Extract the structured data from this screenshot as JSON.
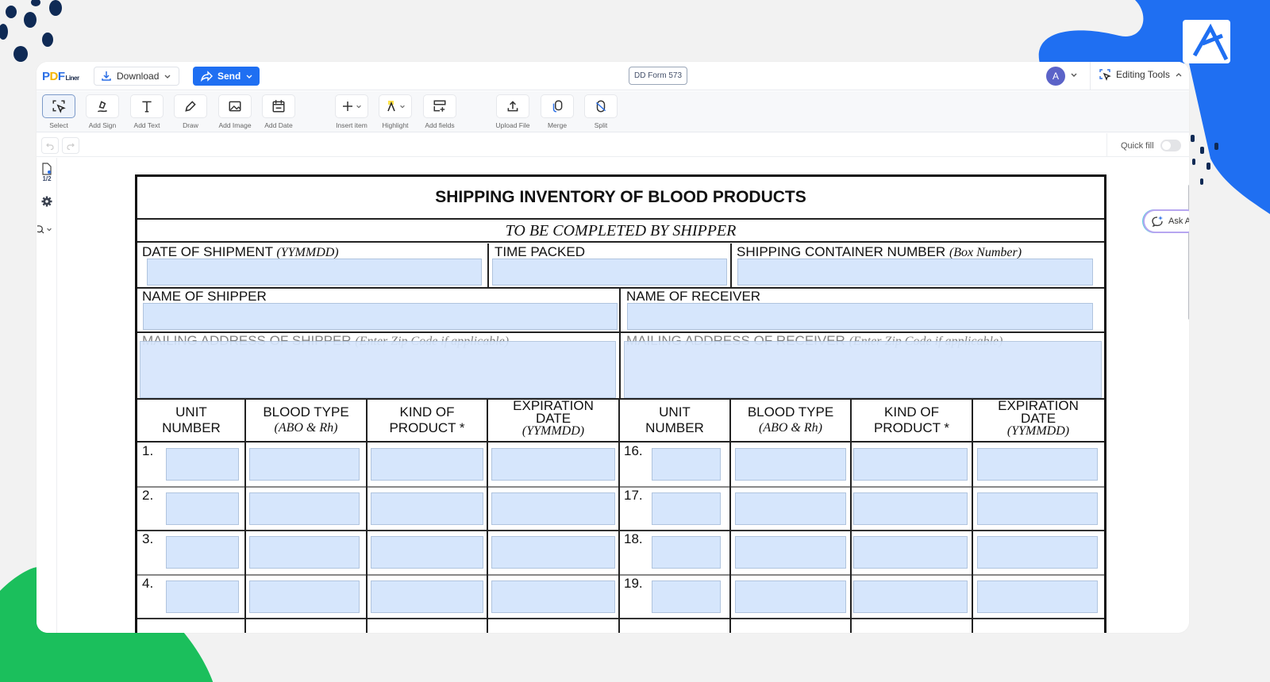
{
  "app": {
    "logo": {
      "p": "P",
      "d": "D",
      "f": "F",
      "liner": "Liner"
    },
    "download_label": "Download",
    "send_label": "Send",
    "document_name": "DD Form 573",
    "avatar_initial": "A",
    "editing_tools_label": "Editing Tools",
    "accent_color": "#1f6ff2"
  },
  "toolbar": {
    "tools": [
      {
        "label": "Select",
        "icon": "select-icon",
        "active": true
      },
      {
        "label": "Add Sign",
        "icon": "sign-icon"
      },
      {
        "label": "Add Text",
        "icon": "text-icon"
      },
      {
        "label": "Draw",
        "icon": "draw-icon"
      },
      {
        "label": "Add Image",
        "icon": "image-icon"
      },
      {
        "label": "Add Date",
        "icon": "calendar-icon"
      },
      {
        "label": "Insert item",
        "icon": "plus-icon"
      },
      {
        "label": "Highlight",
        "icon": "highlight-icon"
      },
      {
        "label": "Add fields",
        "icon": "add-fields-icon"
      },
      {
        "label": "Upload File",
        "icon": "upload-icon"
      },
      {
        "label": "Merge",
        "icon": "merge-icon"
      },
      {
        "label": "Split",
        "icon": "split-icon"
      }
    ]
  },
  "subbar": {
    "quick_fill_label": "Quick fill",
    "quick_fill_on": false
  },
  "sidebar": {
    "page_indicator": "1/2"
  },
  "ask_ai_label": "Ask A",
  "form": {
    "title": "SHIPPING INVENTORY OF BLOOD PRODUCTS",
    "subtitle": "TO BE COMPLETED BY SHIPPER",
    "date_of_shipment": {
      "label": "DATE OF SHIPMENT",
      "hint": "(YYMMDD)",
      "value": ""
    },
    "time_packed": {
      "label": "TIME PACKED",
      "value": ""
    },
    "container_number": {
      "label": "SHIPPING CONTAINER NUMBER",
      "hint": "(Box Number)",
      "value": ""
    },
    "name_of_shipper": {
      "label": "NAME OF SHIPPER",
      "value": ""
    },
    "name_of_receiver": {
      "label": "NAME OF RECEIVER",
      "value": ""
    },
    "mailing_shipper": {
      "label": "MAILING ADDRESS OF SHIPPER",
      "hint": "(Enter Zip Code if applicable)",
      "value": ""
    },
    "mailing_receiver": {
      "label": "MAILING ADDRESS OF RECEIVER",
      "hint": "(Enter Zip Code if applicable)",
      "value": ""
    },
    "columns": {
      "unit": [
        "UNIT",
        "NUMBER"
      ],
      "blood": [
        "BLOOD TYPE",
        "(ABO & Rh)"
      ],
      "kind": [
        "KIND OF",
        "PRODUCT *"
      ],
      "exp": [
        "EXPIRATION",
        "DATE",
        "(YYMMDD)"
      ]
    },
    "left_rows": [
      "1.",
      "2.",
      "3.",
      "4."
    ],
    "right_rows": [
      "16.",
      "17.",
      "18.",
      "19."
    ]
  }
}
